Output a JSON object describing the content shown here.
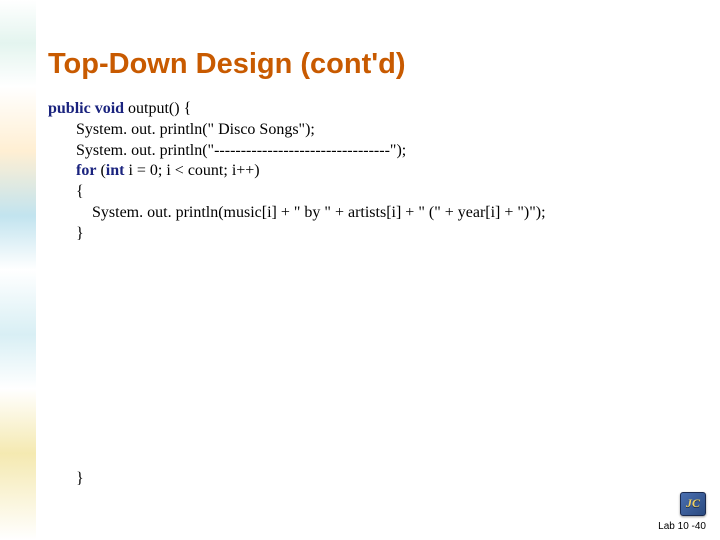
{
  "title": "Top-Down Design (cont'd)",
  "code": {
    "l1": {
      "pre": "public void",
      "rest": " output() {"
    },
    "l2": "System. out. println(\"             Disco Songs\");",
    "l3": "System. out. println(\"---------------------------------\");",
    "l4": {
      "pre1": "for",
      "mid": " (",
      "pre2": "int",
      "rest": " i = 0; i < count; i++)"
    },
    "l5": "{",
    "l6": "System. out. println(music[i] + \" by \" + artists[i] + \" (\" + year[i] + \")\");",
    "l7": "}",
    "l8": "}"
  },
  "footer": "Lab 10 -40"
}
